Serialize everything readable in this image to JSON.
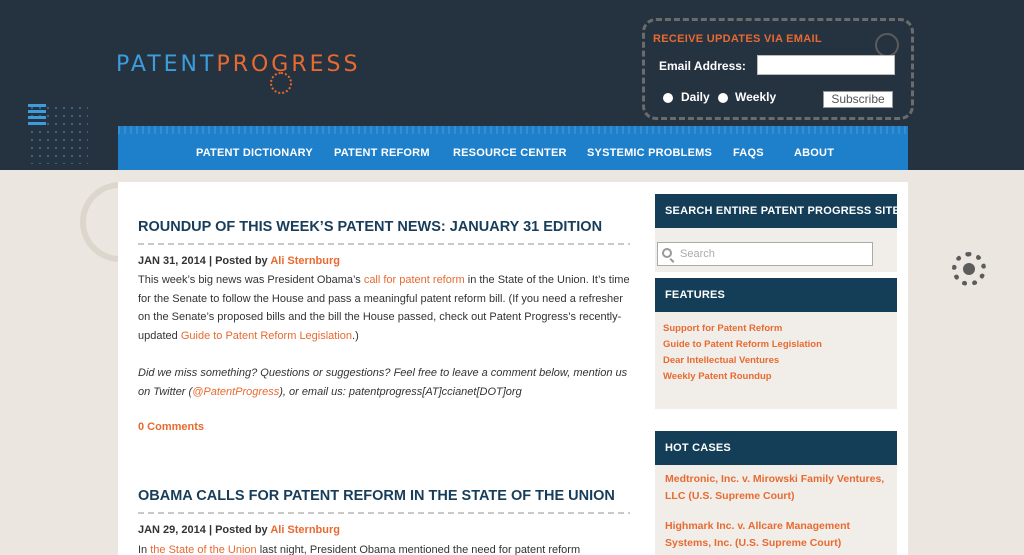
{
  "logo": {
    "part1": "PATENT",
    "part2": "PROGRESS"
  },
  "subscribe": {
    "title": "RECEIVE UPDATES VIA EMAIL",
    "email_label": "Email Address:",
    "email_value": "",
    "option_daily": "Daily",
    "option_weekly": "Weekly",
    "button": "Subscribe"
  },
  "nav": {
    "items": [
      {
        "label": "PATENT DICTIONARY"
      },
      {
        "label": "PATENT REFORM"
      },
      {
        "label": "RESOURCE CENTER"
      },
      {
        "label": "SYSTEMIC PROBLEMS"
      },
      {
        "label": "FAQS"
      },
      {
        "label": "ABOUT"
      }
    ]
  },
  "posts": [
    {
      "title": "ROUNDUP OF THIS WEEK’S PATENT NEWS: JANUARY 31 EDITION",
      "date": "JAN 31, 2014",
      "posted_by": "| Posted by",
      "author": "Ali Sternburg",
      "body1_a": "This week’s big news was President Obama’s ",
      "body1_link": "call for patent reform",
      "body1_b": " in the State of the Union. It’s time for the Senate to follow the House and pass a meaningful patent reform bill. (If you need a refresher on the Senate’s proposed bills and the bill the House passed, check out Patent Progress’s recently-updated ",
      "body1_link2": "Guide to Patent Reform Legislation",
      "body1_c": ".)",
      "body2_a": "Did we miss something?  Questions or suggestions?  Feel free to leave a comment below, mention us on Twitter (",
      "body2_link": "@PatentProgress",
      "body2_b": "), or email us: patentprogress[AT]ccianet[DOT]org",
      "comments": "0 Comments"
    },
    {
      "title": "OBAMA CALLS FOR PATENT REFORM IN THE STATE OF THE UNION",
      "date": "JAN 29, 2014",
      "posted_by": "| Posted by",
      "author": "Ali Sternburg",
      "body1_a": "In ",
      "body1_link": "the State of the Union",
      "body1_b": " last night, President Obama mentioned the need for patent reform"
    }
  ],
  "sidebar": {
    "search_title": "SEARCH ENTIRE PATENT PROGRESS SITE",
    "search_placeholder": "Search",
    "features_title": "FEATURES",
    "features": [
      "Support for Patent Reform",
      "Guide to Patent Reform Legislation",
      "Dear Intellectual Ventures",
      "Weekly Patent Roundup"
    ],
    "hot_cases_title": "HOT CASES",
    "hot_cases": [
      "Medtronic, Inc. v. Mirowski Family Ventures, LLC (U.S. Supreme Court)",
      "Highmark Inc. v. Allcare Management Systems, Inc. (U.S. Supreme Court)"
    ]
  },
  "colors": {
    "header_bg": "#253341",
    "nav_bg": "#1e7fca",
    "accent_orange": "#e86a30",
    "title_navy": "#173d5a",
    "widget_head": "#143d57"
  }
}
